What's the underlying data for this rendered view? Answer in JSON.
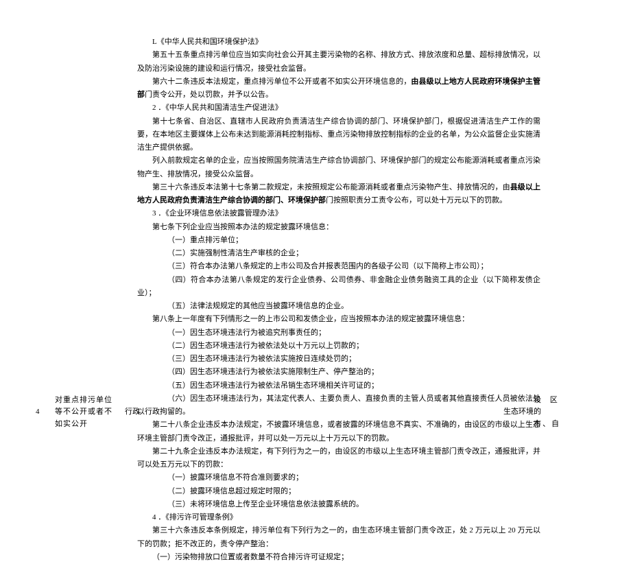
{
  "sec1": {
    "title": "L《中华人民共和国环境保护法》",
    "p1": "第五十五条重点排污单位应当如实向社会公开其主要污染物的名称、排放方式、排放浓度和总量、超标排放情况，以及防治污染设施的建设和运行情况，接受社会监督。",
    "p2a": "第六十二条违反本法规定，重点排污单位不公开或者不如实公开环境信息的，",
    "p2b": "由县级以上地方人民政府环境保护主管部",
    "p2c": "门责令公开，处以罚款，并予以公告。"
  },
  "sec2": {
    "title": "2 ．《中华人民共和国清洁生产促进法》",
    "p1": "第十七条省、自治区、直辖市人民政府负责清洁生产综合协调的部门、环境保护部门，根据促进清洁生产工作的需要，在本地区主要媒体上公布未达到能源消耗控制指标、重点污染物排放控制指标的企业的名单，为公众监督企业实施清洁生产提供依据。",
    "p2": "列入前款规定名单的企业，应当按照国务院清洁生产综合协调部门、环境保护部门的规定公布能源消耗或者重点污染物产生、排放情况，接受公众监督。",
    "p3a": "第三十六条违反本法第十七条第二款规定，未按照规定公布能源消耗或者重点污染物产生、排放情况的，由",
    "p3b": "县级以上地方人民政府负责清洁生产综合协调的部门、环境保护部",
    "p3c": "门按照职责分工责令公布，可以处十万元以下的罚款。"
  },
  "sec3": {
    "title": "3 ．《企业环境信息依法披露管理办法》",
    "a7_intro": "第七条下列企业应当按照本办法的规定披露环境信息：",
    "a7_1": "（一）重点排污单位；",
    "a7_2": "（二）实施强制性清洁生产审核的企业；",
    "a7_3": "（三）符合本办法第八条规定的上市公司及合并报表范围内的各级子公司（以下简称上市公司）；",
    "a7_4": "（四）符合本办法第八条规定的发行企业债券、公司债券、非金融企业债务融资工具的企业（以下简称发债企业）；",
    "a7_5": "（五）法律法规规定的其他应当披露环境信息的企业。",
    "a8_intro": "第八条上一年度有下列情形之一的上市公司和发债企业，应当按照本办法的规定披露环境信息：",
    "a8_1": "（一）因生态环境违法行为被追究刑事责任的；",
    "a8_2": "（二）因生态环境违法行为被依法处以十万元以上罚款的；",
    "a8_3": "（三）因生态环境违法行为被依法实施按日连续处罚的；",
    "a8_4": "（四）因生态环境违法行为被依法实施限制生产、停产整治的；",
    "a8_5": "（五）因生态环境违法行为被依法吊销生态环境相关许可证的；",
    "a8_6": "（六）因生态环境违法行为，其法定代表人、主要负责人、直接负责的主管人员或者其他直接责任人员被依法处以行政拘留的。",
    "a28": "第二十八条企业违反本办法规定，不披露环境信息，或者披露的环境信息不真实、不准确的，由设区的市级以上生态环境主管部门责令改正，通报批评，并可以处一万元以上十万元以下的罚款。",
    "a29_intro": "第二十九条企业违反本办法规定，有下列行为之一的，由设区的市级以上生态环境主管部门责令改正，通报批评，并可以处五万元以下的罚款：",
    "a29_1": "（一）披露环境信息不符合准则要求的；",
    "a29_2": "（二）披露环境信息超过规定时限的；",
    "a29_3": "（三）未将环境信息上传至企业环境信息依法披露系统的。"
  },
  "sec4": {
    "title": "4 ．《排污许可管理条例》",
    "p1": "第三十六条违反本条例规定，排污单位有下列行为之一的，由生态环境主管部门责令改正，处 2 万元以上 20 万元以下的罚款；拒不改正的，责令停产整治：",
    "p1_1": "（一）污染物排放口位置或者数量不符合排污许可证规定；"
  },
  "row": {
    "num": "4",
    "subject_l1": "对重点排污单位",
    "subject_l2": "等不公开或者不",
    "subject_l3": "如实公开",
    "type": "行政",
    "dept": "生态环境",
    "region_l1": "设 区 的",
    "region_l2": "市、自"
  }
}
